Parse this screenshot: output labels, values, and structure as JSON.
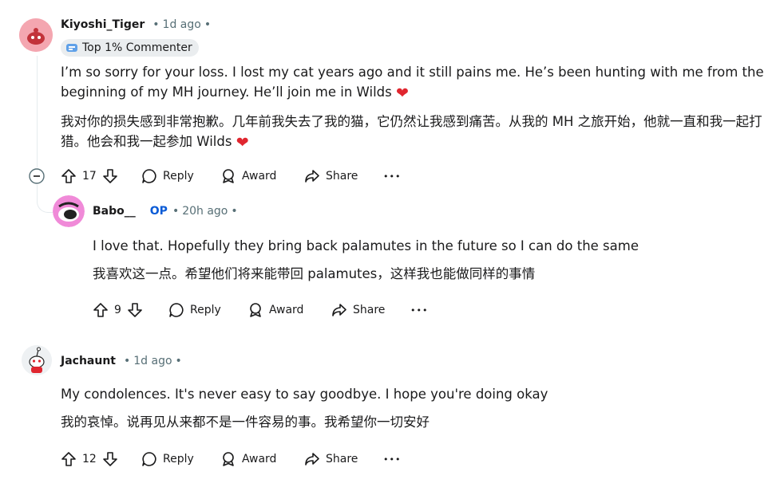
{
  "comments": [
    {
      "username": "Kiyoshi_Tiger",
      "time": "1d ago",
      "badge": "Top 1% Commenter",
      "text_en": "I’m so sorry for your loss. I lost my cat years ago and it still pains me. He’s been hunting with me from the beginning of my MH journey. He’ll join me in Wilds",
      "text_zh": "我对你的损失感到非常抱歉。几年前我失去了我的猫，它仍然让我感到痛苦。从我的 MH 之旅开始，他就一直和我一起打猎。他会和我一起参加 Wilds",
      "votes": "17"
    },
    {
      "username": "Babo__",
      "op_label": "OP",
      "time": "20h ago",
      "text_en": "I love that. Hopefully they bring back palamutes in the future so I can do the same",
      "text_zh": "我喜欢这一点。希望他们将来能带回 palamutes，这样我也能做同样的事情",
      "votes": "9"
    },
    {
      "username": "Jachaunt",
      "time": "1d ago",
      "text_en": "My condolences. It's never easy to say goodbye. I hope you're doing okay",
      "text_zh": "我的哀悼。说再见从来都不是一件容易的事。我希望你一切安好",
      "votes": "12"
    }
  ],
  "actions": {
    "reply": "Reply",
    "award": "Award",
    "share": "Share",
    "more": "•••"
  },
  "separator": "•",
  "heart_glyph": "❤",
  "icons": [
    "snoo-avatar-icon",
    "upvote-icon",
    "downvote-icon",
    "comment-icon",
    "award-icon",
    "share-icon",
    "more-icon",
    "collapse-icon",
    "badge-icon"
  ],
  "colors": {
    "heart": "#e0262f",
    "op": "#0a5bd6",
    "meta": "#576f76",
    "badge_bg": "#eaedef"
  }
}
